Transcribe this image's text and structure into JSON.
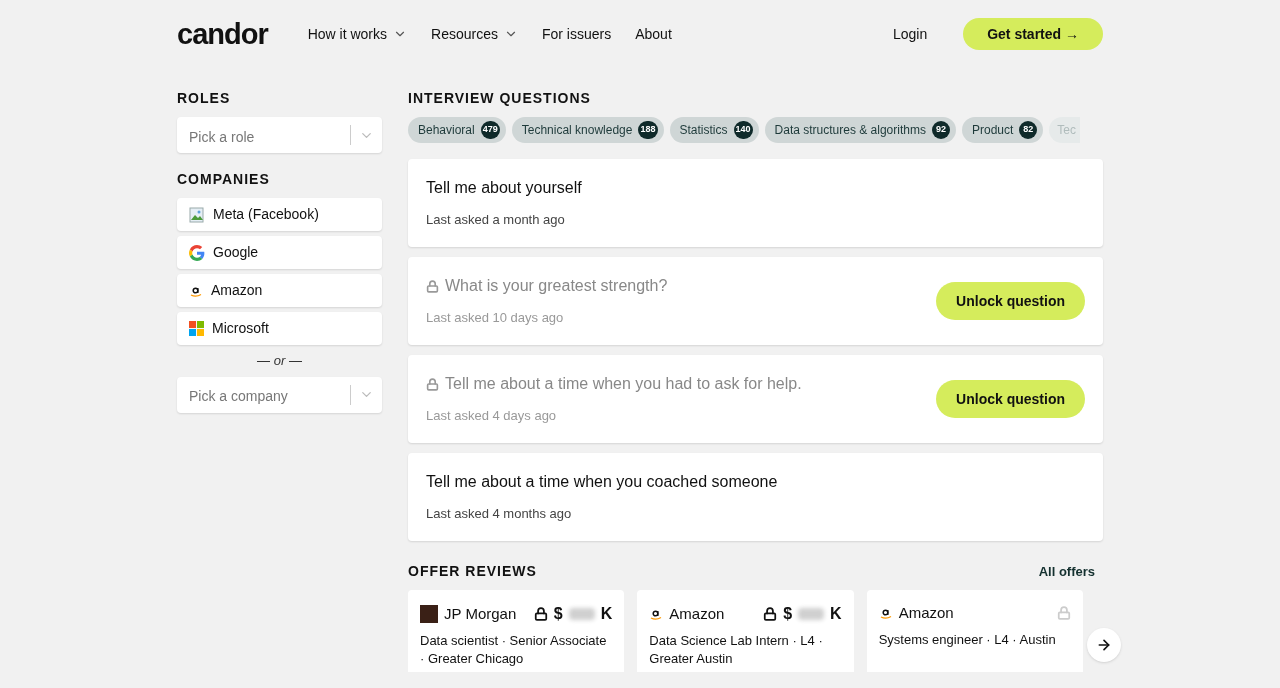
{
  "nav": {
    "logo": "candor",
    "items": [
      {
        "label": "How it works",
        "dropdown": true
      },
      {
        "label": "Resources",
        "dropdown": true
      },
      {
        "label": "For issuers",
        "dropdown": false
      },
      {
        "label": "About",
        "dropdown": false
      }
    ],
    "login": "Login",
    "cta": "Get started →"
  },
  "sidebar": {
    "roles_title": "ROLES",
    "role_placeholder": "Pick a role",
    "companies_title": "COMPANIES",
    "companies": [
      {
        "name": "Meta (Facebook)",
        "kind": "broken-image"
      },
      {
        "name": "Google",
        "kind": "google"
      },
      {
        "name": "Amazon",
        "kind": "amazon"
      },
      {
        "name": "Microsoft",
        "kind": "microsoft"
      }
    ],
    "or": "— or —",
    "company_placeholder": "Pick a company"
  },
  "questions": {
    "title": "INTERVIEW QUESTIONS",
    "chips": [
      {
        "label": "Behavioral",
        "count": "479"
      },
      {
        "label": "Technical knowledge",
        "count": "188"
      },
      {
        "label": "Statistics",
        "count": "140"
      },
      {
        "label": "Data structures & algorithms",
        "count": "92"
      },
      {
        "label": "Product",
        "count": "82"
      },
      {
        "label": "Tec"
      }
    ],
    "items": [
      {
        "title": "Tell me about yourself",
        "meta": "Last asked a month ago",
        "locked": false
      },
      {
        "title": "What is your greatest strength?",
        "meta": "Last asked 10 days ago",
        "locked": true,
        "button": "Unlock question"
      },
      {
        "title": "Tell me about a time when you had to ask for help.",
        "meta": "Last asked 4 days ago",
        "locked": true,
        "button": "Unlock question"
      },
      {
        "title": "Tell me about a time when you coached someone",
        "meta": "Last asked 4 months ago",
        "locked": false
      }
    ]
  },
  "offers": {
    "title": "OFFER REVIEWS",
    "link": "All offers",
    "cards": [
      {
        "company": "JP Morgan",
        "kind": "jpmorgan",
        "locked": true,
        "salary": "$",
        "suffix": "K",
        "role": "Data scientist · Senior Associate · Greater Chicago"
      },
      {
        "company": "Amazon",
        "kind": "amazon",
        "locked": true,
        "salary": "$",
        "suffix": "K",
        "role": "Data Science Lab Intern · L4 · Greater Austin"
      },
      {
        "company": "Amazon",
        "kind": "amazon",
        "locked": true,
        "role": "Systems engineer · L4 · Austin"
      }
    ]
  }
}
